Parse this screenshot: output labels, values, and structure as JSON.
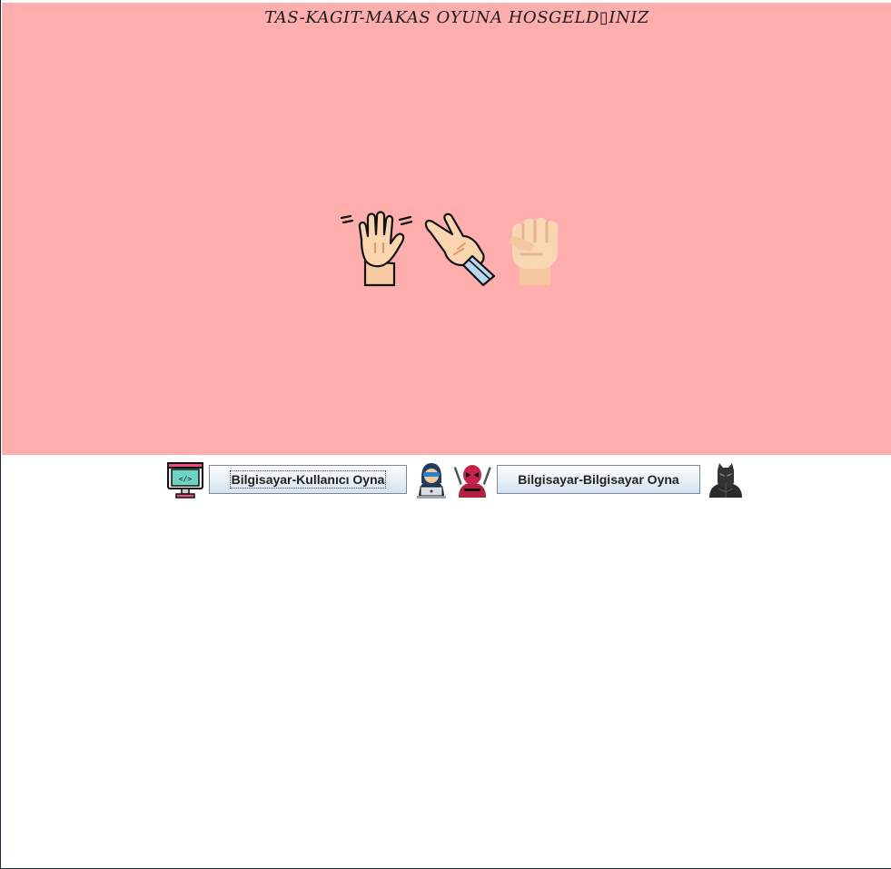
{
  "welcome": {
    "title": "TAS-KAGIT-MAKAS OYUNA HOSGELD▯INIZ",
    "background_color": "#ffaeae"
  },
  "hands": {
    "icons": [
      "paper-hand-icon",
      "scissors-hand-icon",
      "rock-fist-icon"
    ]
  },
  "controls": {
    "user_mode_label": "Bilgisayar-Kullanıcı Oyna",
    "computer_mode_label": "Bilgisayar-Bilgisayar Oyna",
    "icons": [
      "computer-monitor-icon",
      "hacker-laptop-icon",
      "deadpool-icon",
      "black-panther-icon"
    ]
  }
}
